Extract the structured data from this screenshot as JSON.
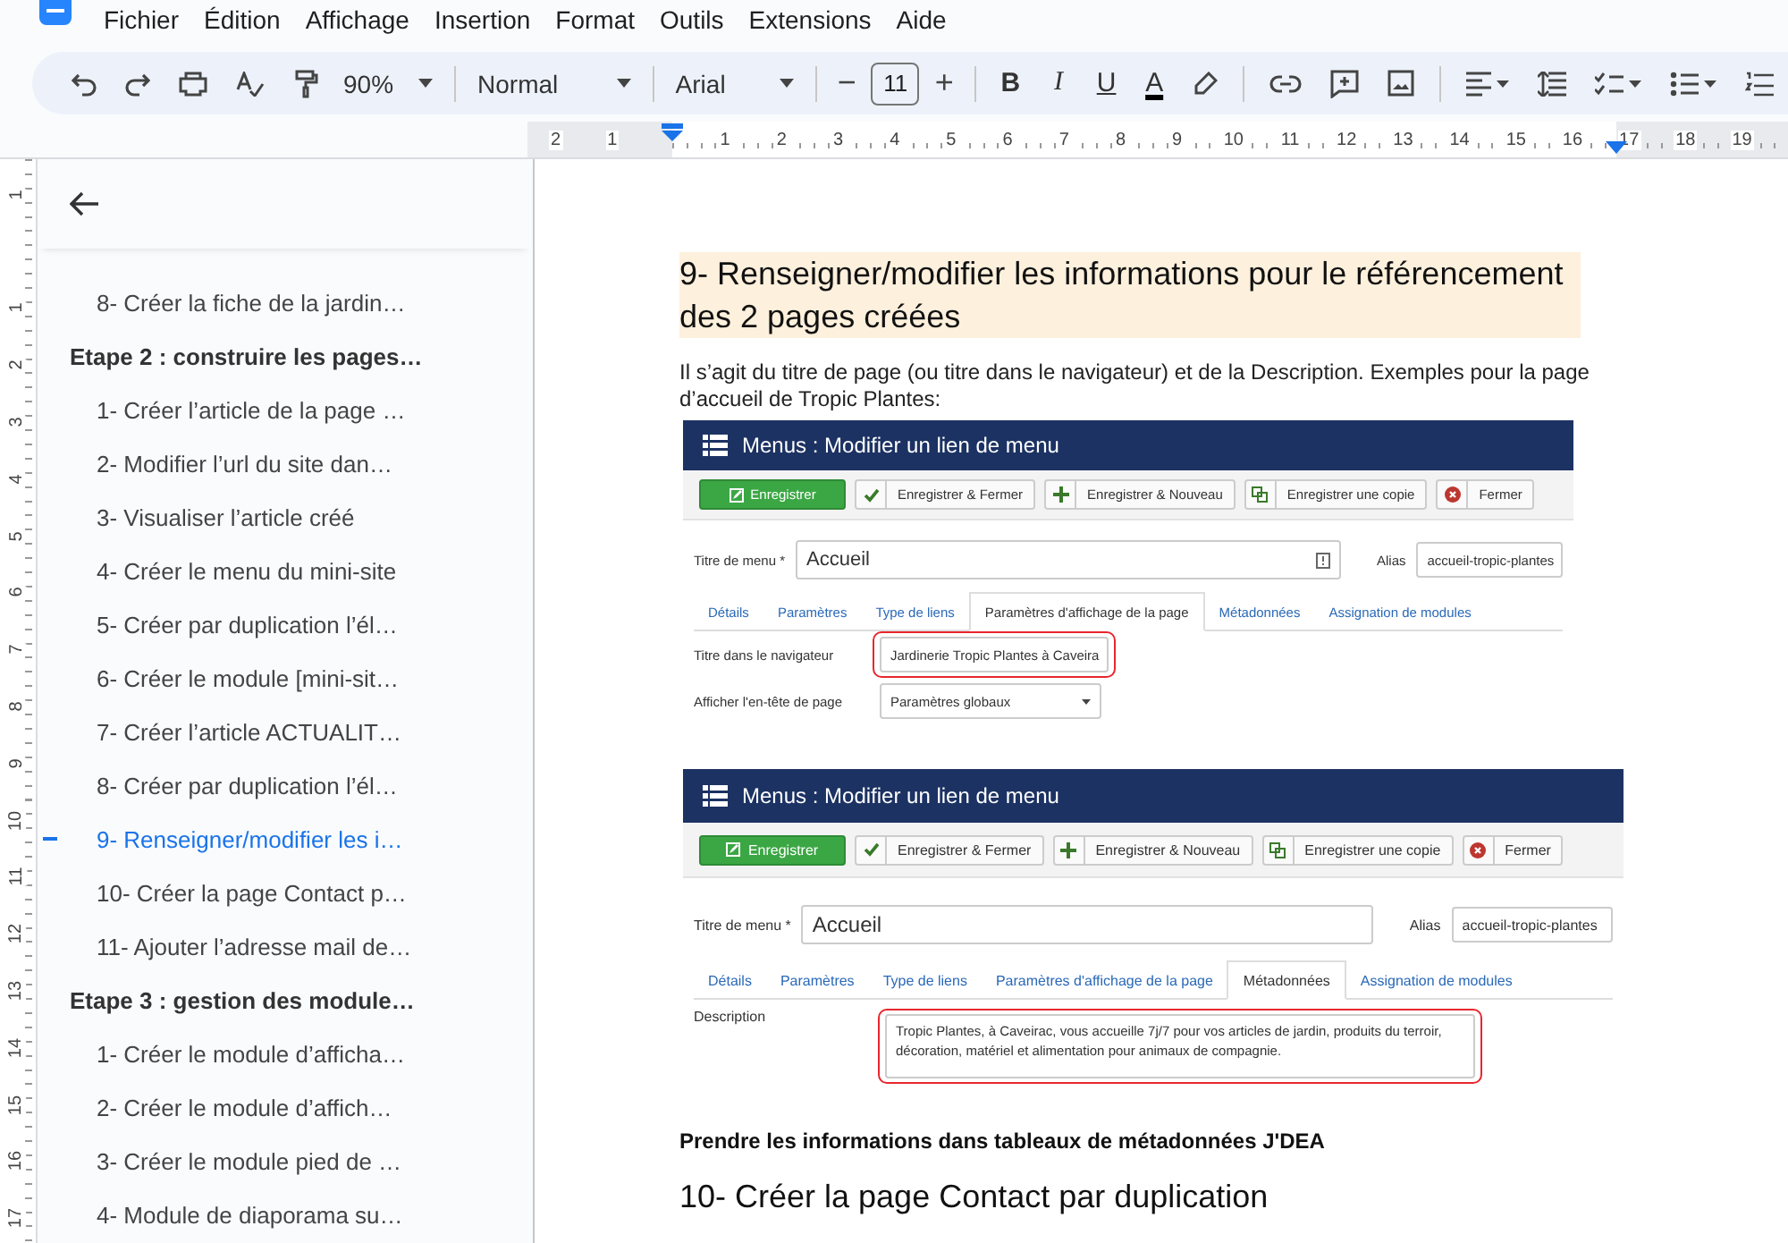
{
  "menu_bar": {
    "items": [
      "Fichier",
      "Édition",
      "Affichage",
      "Insertion",
      "Format",
      "Outils",
      "Extensions",
      "Aide"
    ]
  },
  "toolbar": {
    "zoom": "90%",
    "style": "Normal",
    "font": "Arial",
    "decrease": "−",
    "font_size": "11",
    "increase": "+",
    "format_buttons": [
      {
        "label": "B",
        "kind": "bold"
      },
      {
        "label": "I",
        "kind": "italic"
      },
      {
        "label": "U",
        "kind": "underline"
      },
      {
        "label": "A",
        "kind": "color"
      }
    ]
  },
  "ruler": {
    "labels": [
      "2",
      "1",
      "1",
      "2",
      "3",
      "4",
      "5",
      "6",
      "7",
      "8",
      "9",
      "10",
      "11",
      "12",
      "13",
      "14",
      "15",
      "16",
      "17",
      "18",
      "19"
    ]
  },
  "vertical_ruler": {
    "labels": [
      "1",
      "1",
      "2",
      "3",
      "4",
      "5",
      "6",
      "7",
      "8",
      "9",
      "10",
      "11",
      "12",
      "13",
      "14",
      "15",
      "16",
      "17"
    ]
  },
  "outline": {
    "orphans": [
      {
        "label": "8- Créer la fiche de la jardin…",
        "selected": false
      }
    ],
    "sections": [
      {
        "label": "Etape 2 : construire les pages…",
        "selected": false,
        "children": [
          {
            "label": "1- Créer l’article de la page …",
            "selected": false
          },
          {
            "label": "2- Modifier l’url du site dan…",
            "selected": false
          },
          {
            "label": "3- Visualiser l’article créé",
            "selected": false
          },
          {
            "label": "4- Créer le menu du mini-site",
            "selected": false
          },
          {
            "label": "5- Créer par duplication l’él…",
            "selected": false
          },
          {
            "label": "6- Créer le module [mini-sit…",
            "selected": false
          },
          {
            "label": "7- Créer l’article ACTUALIT…",
            "selected": false
          },
          {
            "label": "8- Créer par duplication l’él…",
            "selected": false
          },
          {
            "label": "9- Renseigner/modifier les i…",
            "selected": true
          },
          {
            "label": "10- Créer la page Contact p…",
            "selected": false
          },
          {
            "label": "11- Ajouter l’adresse mail de…",
            "selected": false
          }
        ]
      },
      {
        "label": "Etape 3 : gestion des module…",
        "selected": false,
        "children": [
          {
            "label": "1- Créer le module d’afficha…",
            "selected": false
          },
          {
            "label": "2- Créer le module d’affich…",
            "selected": false
          },
          {
            "label": "3- Créer le module pied de …",
            "selected": false
          },
          {
            "label": "4- Module de diaporama su…",
            "selected": false
          }
        ]
      }
    ]
  },
  "document": {
    "heading": "9- Renseigner/modifier les informations pour le référencement des 2 pages créées",
    "intro": "Il s’agit du titre de page (ou titre dans le navigateur) et de la Description. Exemples pour la page d’accueil de Tropic Plantes:",
    "screenshots": [
      {
        "title": "Menus : Modifier un lien de menu",
        "buttons": [
          {
            "label": "Enregistrer",
            "kind": "save"
          },
          {
            "label": "Enregistrer & Fermer",
            "kind": "check"
          },
          {
            "label": "Enregistrer & Nouveau",
            "kind": "plus"
          },
          {
            "label": "Enregistrer une copie",
            "kind": "copy"
          },
          {
            "label": "Fermer",
            "kind": "close"
          }
        ],
        "title_label": "Titre de menu *",
        "title_value": "Accueil",
        "title_icon": true,
        "alias_label": "Alias",
        "alias_value": "accueil-tropic-plantes",
        "tabs": [
          {
            "label": "Détails",
            "selected": false
          },
          {
            "label": "Paramètres",
            "selected": false
          },
          {
            "label": "Type de liens",
            "selected": false
          },
          {
            "label": "Paramètres d'affichage de la page",
            "selected": true
          },
          {
            "label": "Métadonnées",
            "selected": false
          },
          {
            "label": "Assignation de modules",
            "selected": false
          }
        ],
        "fields": [
          {
            "kind": "input",
            "label": "Titre dans le navigateur",
            "value": "Jardinerie Tropic Plantes à Caveira",
            "highlighted": true
          },
          {
            "kind": "select",
            "label": "Afficher l'en-tête de page",
            "value": "Paramètres globaux",
            "highlighted": false
          }
        ]
      },
      {
        "title": "Menus : Modifier un lien de menu",
        "buttons": [
          {
            "label": "Enregistrer",
            "kind": "save"
          },
          {
            "label": "Enregistrer & Fermer",
            "kind": "check"
          },
          {
            "label": "Enregistrer & Nouveau",
            "kind": "plus"
          },
          {
            "label": "Enregistrer une copie",
            "kind": "copy"
          },
          {
            "label": "Fermer",
            "kind": "close"
          }
        ],
        "title_label": "Titre de menu *",
        "title_value": "Accueil",
        "title_icon": false,
        "alias_label": "Alias",
        "alias_value": "accueil-tropic-plantes",
        "tabs": [
          {
            "label": "Détails",
            "selected": false
          },
          {
            "label": "Paramètres",
            "selected": false
          },
          {
            "label": "Type de liens",
            "selected": false
          },
          {
            "label": "Paramètres d'affichage de la page",
            "selected": false
          },
          {
            "label": "Métadonnées",
            "selected": true
          },
          {
            "label": "Assignation de modules",
            "selected": false
          }
        ],
        "fields": [
          {
            "kind": "textarea",
            "label": "Description",
            "value": "Tropic Plantes, à Caveirac, vous accueille 7j/7 pour vos articles de jardin, produits du terroir, décoration, matériel et alimentation pour animaux de compagnie.",
            "highlighted": true
          }
        ]
      }
    ],
    "note": "Prendre les informations dans tableaux de métadonnées J'DEA",
    "next_heading": "10- Créer la page Contact par duplication"
  }
}
